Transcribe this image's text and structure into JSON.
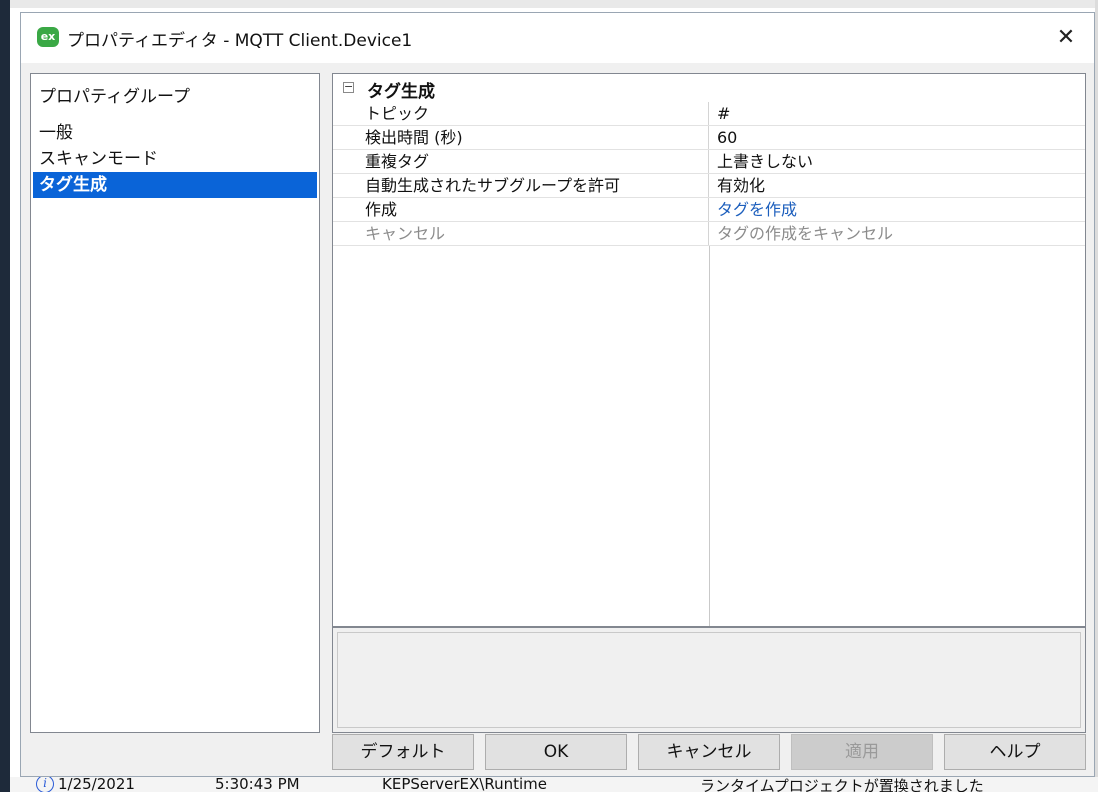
{
  "dialog": {
    "title": "プロパティエディタ - MQTT Client.Device1",
    "app_icon_text": "ex",
    "close_symbol": "✕"
  },
  "groups": {
    "header": "プロパティグループ",
    "items": [
      {
        "label": "一般",
        "selected": false
      },
      {
        "label": "スキャンモード",
        "selected": false
      },
      {
        "label": "タグ生成",
        "selected": true
      }
    ]
  },
  "property_grid": {
    "category": {
      "label": "タグ生成",
      "toggle": "⊟"
    },
    "rows": [
      {
        "name": "トピック",
        "value": "#"
      },
      {
        "name": "検出時間 (秒)",
        "value": "60"
      },
      {
        "name": "重複タグ",
        "value": "上書きしない"
      },
      {
        "name": "自動生成されたサブグループを許可",
        "value": "有効化"
      },
      {
        "name": "作成",
        "value": "タグを作成"
      },
      {
        "name": "キャンセル",
        "value": "タグの作成をキャンセル"
      }
    ]
  },
  "buttons": {
    "default": "デフォルト",
    "ok": "OK",
    "cancel": "キャンセル",
    "apply": "適用",
    "help": "ヘルプ"
  },
  "background_status": {
    "date": "1/25/2021",
    "time": "5:30:43 PM",
    "source": "KEPServerEX\\Runtime",
    "message": "ランタイムプロジェクトが置換されました"
  }
}
